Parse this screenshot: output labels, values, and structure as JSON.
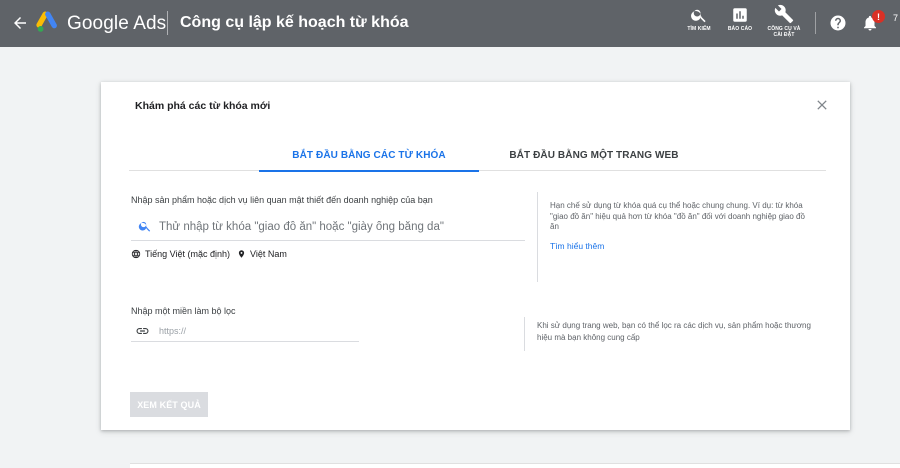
{
  "header": {
    "brand": "Google Ads",
    "page_title": "Công cụ lập kế hoạch từ khóa",
    "tools": {
      "search_label": "TÌM KIẾM",
      "reports_label": "BÁO CÁO",
      "tools_label_line1": "CÔNG CỤ VÀ",
      "tools_label_line2": "CÀI ĐẶT"
    },
    "notification_count": "!",
    "account_truncated": "7",
    "colors": {
      "bar_background": "#5f6368",
      "badge": "#d93025"
    },
    "icons": [
      "back-arrow-icon",
      "google-ads-logo",
      "search-icon",
      "reports-icon",
      "wrench-icon",
      "help-icon",
      "bell-icon"
    ]
  },
  "dialog": {
    "title": "Khám phá các từ khóa mới",
    "tabs": [
      {
        "label": "BẮT ĐẦU BẰNG CÁC TỪ KHÓA",
        "active": true
      },
      {
        "label": "BẮT ĐẦU BẰNG MỘT TRANG WEB",
        "active": false
      }
    ],
    "products_label": "Nhập sản phẩm hoặc dịch vụ liên quan mật thiết đến doanh nghiệp của bạn",
    "keyword_input": {
      "value": "",
      "placeholder": "Thử nhập từ khóa \"giao đồ ăn\" hoặc \"giày ống bằng da\""
    },
    "language": "Tiếng Việt (mặc định)",
    "location": "Việt Nam",
    "tip_keywords": "Hạn chế sử dụng từ khóa quá cụ thể hoặc chung chung. Ví dụ: từ khóa \"giao đồ ăn\" hiệu quả hơn từ khóa \"đồ ăn\" đối với doanh nghiệp giao đồ ăn",
    "learn_more": "Tìm hiểu thêm",
    "domain_label": "Nhập một miền làm bộ lọc",
    "url_input": {
      "value": "",
      "placeholder": "https://"
    },
    "tip_website": "Khi sử dụng trang web, bạn có thể lọc ra các dịch vụ, sản phẩm hoặc thương hiệu mà bạn không cung cấp",
    "results_button": "XEM KẾT QUẢ",
    "colors": {
      "accent": "#1a73e8",
      "disabled_button": "#dadce0"
    }
  }
}
